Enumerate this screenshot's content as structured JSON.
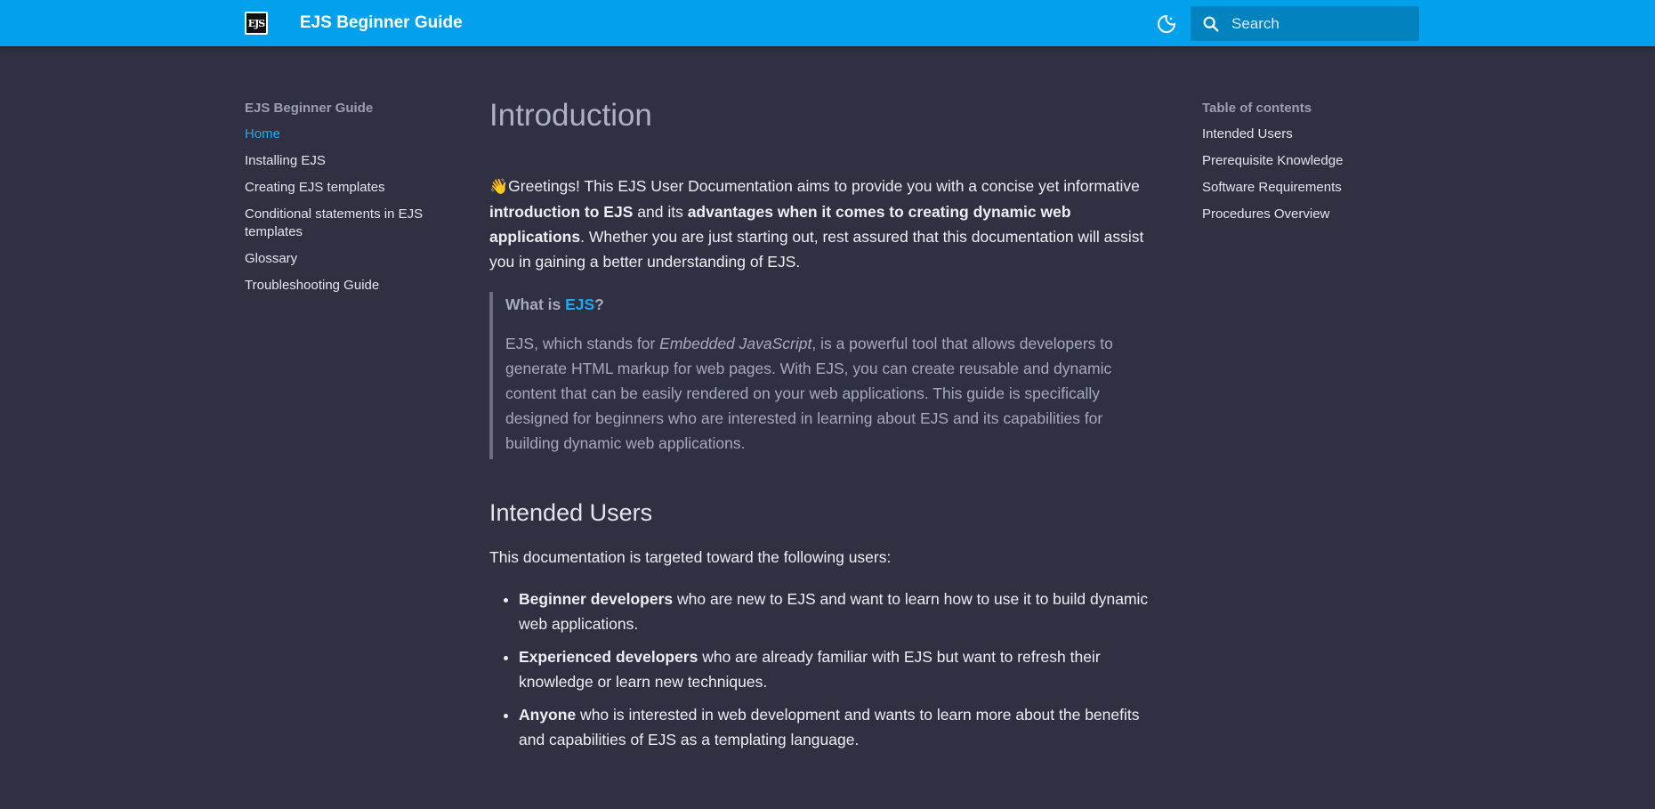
{
  "header": {
    "logo_text": "EJS",
    "site_title": "EJS Beginner Guide",
    "search_placeholder": "Search",
    "theme_toggle_icon": "moon-icon"
  },
  "left_nav": {
    "heading": "EJS Beginner Guide",
    "items": [
      {
        "label": "Home",
        "active": true
      },
      {
        "label": "Installing EJS"
      },
      {
        "label": "Creating EJS templates"
      },
      {
        "label": "Conditional statements in EJS templates"
      },
      {
        "label": "Glossary"
      },
      {
        "label": "Troubleshooting Guide"
      }
    ]
  },
  "toc": {
    "heading": "Table of contents",
    "items": [
      "Intended Users",
      "Prerequisite Knowledge",
      "Software Requirements",
      "Procedures Overview"
    ]
  },
  "main": {
    "title": "Introduction",
    "intro": {
      "emoji": "👋",
      "t1": "Greetings! This EJS User Documentation aims to provide you with a concise yet informative ",
      "b1": "introduction to EJS",
      "t2": " and its ",
      "b2": "advantages when it comes to creating dynamic web applications",
      "t3": ". Whether you are just starting out, rest assured that this documentation will assist you in gaining a better understanding of EJS."
    },
    "callout": {
      "title_prefix": "What is ",
      "title_link": "EJS",
      "title_suffix": "?",
      "body_prefix": "EJS, which stands for ",
      "body_em": "Embedded JavaScript",
      "body_rest": ", is a powerful tool that allows developers to generate HTML markup for web pages. With EJS, you can create reusable and dynamic content that can be easily rendered on your web applications. This guide is specifically designed for beginners who are interested in learning about EJS and its capabilities for building dynamic web applications."
    },
    "section_heading": "Intended Users",
    "section_intro": "This documentation is targeted toward the following users:",
    "users": [
      {
        "bold": "Beginner developers",
        "rest": " who are new to EJS and want to learn how to use it to build dynamic web applications."
      },
      {
        "bold": "Experienced developers",
        "rest": " who are already familiar with EJS but want to refresh their knowledge or learn new techniques."
      },
      {
        "bold": "Anyone",
        "rest": " who is interested in web development and wants to learn more about the benefits and capabilities of EJS as a templating language."
      }
    ]
  },
  "colors": {
    "header_bg": "#03a0eb",
    "page_bg": "#2f3142",
    "accent": "#21a7ee"
  }
}
